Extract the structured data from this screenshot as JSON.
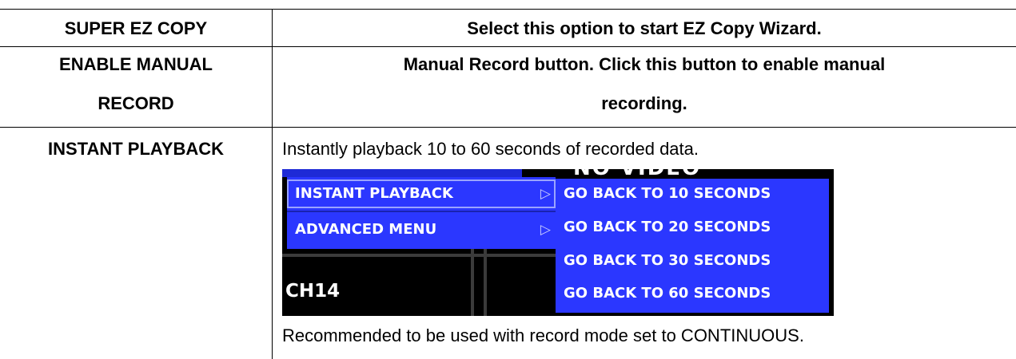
{
  "rows": [
    {
      "label": "SUPER EZ COPY",
      "description": "Select this option to start EZ Copy Wizard."
    },
    {
      "label_line1": "ENABLE MANUAL",
      "label_line2": "RECORD",
      "description_line1": "Manual Record button. Click this button to enable manual",
      "description_line2": "recording."
    },
    {
      "label": "INSTANT PLAYBACK",
      "description": "Instantly playback 10 to 60 seconds of recorded data.",
      "note": "Recommended to be used with record mode set to CONTINUOUS."
    }
  ],
  "dvr_screen": {
    "overlay_text": "NO VIDEO",
    "channel_label": "CH14",
    "menu": [
      {
        "label": "INSTANT PLAYBACK",
        "arrow_icon": "triangle-right-icon",
        "selected": true
      },
      {
        "label": "ADVANCED MENU",
        "arrow_icon": "triangle-right-icon",
        "selected": false
      }
    ],
    "submenu": [
      "GO BACK TO 10 SECONDS",
      "GO BACK TO 20 SECONDS",
      "GO BACK TO 30 SECONDS",
      "GO BACK TO 60 SECONDS"
    ],
    "colors": {
      "menu_bg": "#2b37ff",
      "screen_bg": "#000000"
    }
  }
}
